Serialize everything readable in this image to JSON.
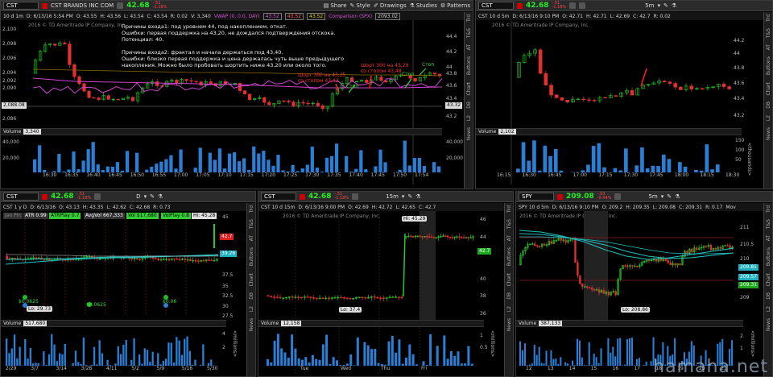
{
  "chart1": {
    "symbol": "CST",
    "aggregation": "10 d 1m",
    "last": "42.68",
    "change": "-.51",
    "change_pct": "-1.18%",
    "company": "CST BRANDS INC COM",
    "buttons": [
      "Share",
      "Style",
      "Drawings",
      "Studies",
      "Patterns"
    ],
    "info": [
      "D: 6/13/16 5:54 PM",
      "O: 43.55",
      "H: 43.56",
      "L: 43.54",
      "C: 43.54",
      "R: 0.02",
      "V: 3,340",
      "VWAP (0, 0.0, DAY)",
      "43.52",
      "43.52",
      "43.52",
      "Comparison (SPX)",
      "2093.02"
    ],
    "copyright": "2016 © TD Ameritrade IP Company, Inc.",
    "left_axis": [
      "2,100",
      "2,098",
      "2,096",
      "2,094",
      "2,092",
      "2,090",
      "2,088.08",
      "2,086"
    ],
    "right_axis": [
      "44.4",
      "44.2",
      "44",
      "43.8",
      "43.6",
      "43.4",
      "43.32",
      "43.2"
    ],
    "time_axis": [
      "16:30",
      "16:35",
      "16:40",
      "16:45",
      "16:50",
      "16:55",
      "17:00",
      "17:05",
      "17:10",
      "17:15",
      "17:20",
      "17:25",
      "17:30",
      "17:35",
      "17:40",
      "17:45",
      "17:50",
      "17:54"
    ],
    "annotation": "Причины входа1: под уровнем 44, под накоплением, откат.\nОшибки: первая поддержка на 43,20, не дождался подтверждения отскока.\nПотенциал: 40.\n\nПричины входа2: фрактал и начала держаться под 43,40.\nОшибки: близко первая поддержка и цена держалась чуть выше предыдущего\nнакопления. Можно было пробовать шортить ниже 43,20 или около того.",
    "callout1": "Шорт 300 на 43,25\nсо стопом 43,42",
    "callout2": "Шорт 300 на 43,29\nсо стопом 43,48",
    "stops": [
      "Стоп",
      "Стоп",
      "Стоп"
    ],
    "volume_label": "Volume",
    "volume_value": "3,340",
    "volume_axis": [
      "40,000",
      "20,000"
    ],
    "sidebar": [
      "Trd",
      "T&S",
      "AT",
      "Buttons",
      "Chart",
      "DB",
      "L2",
      "News"
    ]
  },
  "chart2": {
    "symbol": "CST",
    "last": "42.68",
    "change": "-.51",
    "change_pct": "-1.18%",
    "period": "5m",
    "info": [
      "CST 10 d 5m",
      "D: 6/13/16 9:10 PM",
      "O: 42.71",
      "H: 42.71",
      "L: 42.69",
      "C: 42.7",
      "R: 0.02"
    ],
    "copyright": "2016 © TD Ameritrade IP Company, Inc.",
    "right_axis": [
      "44.2",
      "44",
      "43.8",
      "43.6",
      "43.4",
      "43.2"
    ],
    "time_axis": [
      "16:15",
      "16:30",
      "16:45",
      "17:00",
      "17:15",
      "17:30",
      "17:45",
      "18:00",
      "18:15",
      "18:30"
    ],
    "volume_label": "Volume",
    "volume_value": "2,102",
    "volume_axis": [
      "150",
      "100",
      "50"
    ],
    "volume_unit": "<thousands>"
  },
  "chart3": {
    "symbol": "CST",
    "last": "42.68",
    "change": "-.51",
    "change_pct": "-1.18%",
    "period": "D",
    "info": [
      "CST 1 y D",
      "D: 6/13/16",
      "O: 43.13",
      "H: 43.35",
      "L: 42.62",
      "C: 42.68",
      "R: 0.73"
    ],
    "studies": [
      "Jan Pin",
      "ATR 0.99",
      "ATRPlay 0.7",
      "AvgVol 667,333",
      "Vol $17,680",
      "VolPlay 0.8"
    ],
    "hi_label": "Hi: 45.28",
    "lo_label": "Lo: 29.73",
    "tags": [
      "42.7",
      "39.26"
    ],
    "right_axis": [
      "45",
      "42.5",
      "40",
      "37.5",
      "35",
      "32.5",
      "30",
      "27.5"
    ],
    "dividends": [
      "$0.0625",
      "$0.0625",
      "$0.06"
    ],
    "time_axis": [
      "2/29",
      "3/7",
      "3/14",
      "3/28",
      "4/11",
      "5/2",
      "5/9",
      "5/16",
      "5/30"
    ],
    "volume_label": "Volume",
    "volume_value": "517,680",
    "volume_unit": "<millions>",
    "volume_axis": [
      "4",
      "2"
    ]
  },
  "chart4": {
    "symbol": "CST",
    "last": "42.68",
    "change": "-.51",
    "change_pct": "-1.18%",
    "period": "15m",
    "info": [
      "CST 10 d 15m",
      "D: 6/13/16 9:00 PM",
      "O: 42.69",
      "H: 42.72",
      "L: 42.65",
      "C: 42.7"
    ],
    "copyright": "2016 © TD Ameritrade IP Company, Inc.",
    "hi_label": "Hi: 45.29",
    "lo_label": "Lo: 37.4",
    "tag": "42.7",
    "right_axis": [
      "46",
      "44",
      "42",
      "40",
      "38",
      "36"
    ],
    "time_axis": [
      "Tue",
      "Wed",
      "Thu",
      "Fri"
    ],
    "volume_label": "Volume",
    "volume_value": "12,158",
    "volume_unit": "<millions>",
    "volume_axis": [
      "1",
      "0.5"
    ]
  },
  "chart5": {
    "symbol": "SPY",
    "last": "209.08",
    "change": "-.93",
    "change_pct": "-0.44%",
    "period": "5m",
    "info": [
      "SPY 10 d 5m",
      "D: 6/13/16 9:10 PM",
      "O: 209.2",
      "H: 209.35",
      "L: 209.08",
      "C: 209.31",
      "R: 0.17",
      "Mov"
    ],
    "copyright": "2016 © TD Ameritrade IP Company, Inc.",
    "lo_label": "Lo: 208.86",
    "tags": [
      "209.81",
      "209.57",
      "209.31"
    ],
    "right_axis": [
      "211",
      "210.5",
      "210",
      "209.5",
      "209"
    ],
    "time_axis": [
      "12",
      "13",
      "14",
      "15",
      "16",
      "17",
      "18",
      "19",
      "20",
      "21"
    ],
    "volume_label": "Volume",
    "volume_value": "387,133",
    "volume_unit": "<millions>",
    "volume_axis": [
      "2",
      "1"
    ]
  },
  "watermark": "hamaha.net",
  "colors": {
    "up": "#22cc22",
    "down": "#e03030",
    "vwap": "#cc44cc",
    "ma": "#22c0c0",
    "grid": "#1c1c1c"
  }
}
